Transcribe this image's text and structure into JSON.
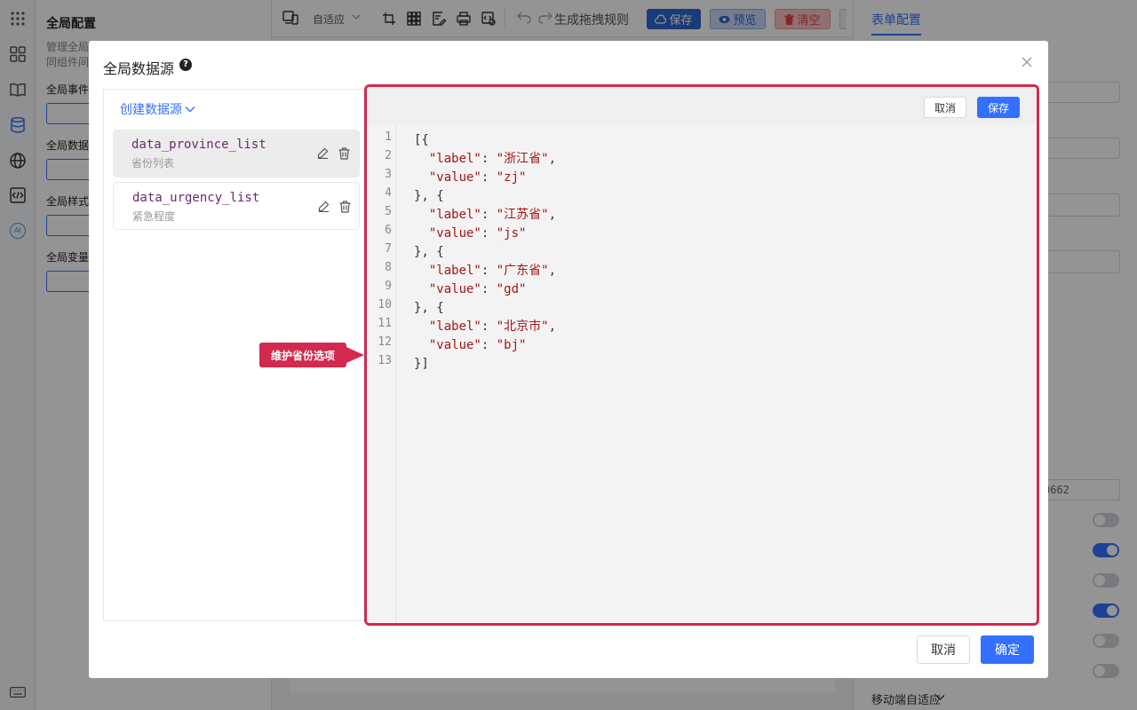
{
  "colors": {
    "accent": "#3370ff",
    "highlight": "#d4294e",
    "danger": "#f04c4c"
  },
  "rail": {
    "icons": [
      "apps-icon",
      "components-icon",
      "book-icon",
      "database-icon",
      "globe-icon",
      "code-icon",
      "ai-icon",
      "keyboard-icon"
    ],
    "ai_label": "AI"
  },
  "left_panel": {
    "title": "全局配置",
    "desc_line1": "管理全局",
    "desc_line2": "同组件间",
    "sections": [
      "全局事件",
      "全局数据",
      "全局样式",
      "全局变量"
    ]
  },
  "toolbar": {
    "adapt_label": "自适应",
    "rule_label": "生成拖拽规则",
    "save_label": "保存",
    "preview_label": "预览",
    "clear_label": "清空"
  },
  "right_panel": {
    "tab_label": "表单配置",
    "field_value": "0662",
    "mobile_label": "移动端自适应",
    "switches": [
      false,
      true,
      false,
      true,
      false,
      false
    ]
  },
  "dialog": {
    "title": "全局数据源",
    "help": "?",
    "create_label": "创建数据源",
    "datasources": [
      {
        "name": "data_province_list",
        "desc": "省份列表",
        "selected": true
      },
      {
        "name": "data_urgency_list",
        "desc": "紧急程度",
        "selected": false
      }
    ],
    "editor": {
      "cancel_label": "取消",
      "save_label": "保存",
      "lines": [
        "[{",
        "  \"label\": \"浙江省\",",
        "  \"value\": \"zj\"",
        "}, {",
        "  \"label\": \"江苏省\",",
        "  \"value\": \"js\"",
        "}, {",
        "  \"label\": \"广东省\",",
        "  \"value\": \"gd\"",
        "}, {",
        "  \"label\": \"北京市\",",
        "  \"value\": \"bj\"",
        "}]"
      ],
      "line_numbers": [
        "1",
        "2",
        "3",
        "4",
        "5",
        "6",
        "7",
        "8",
        "9",
        "10",
        "11",
        "12",
        "13"
      ]
    },
    "callout": "维护省份选项",
    "cancel_label": "取消",
    "confirm_label": "确定"
  }
}
